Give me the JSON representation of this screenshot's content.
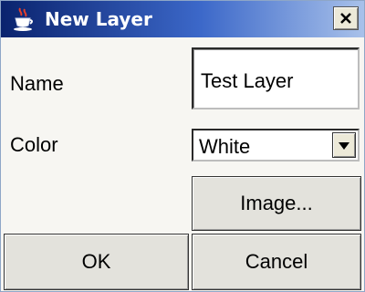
{
  "window": {
    "title": "New Layer",
    "title_icon": "java-cup-icon",
    "close_icon": "close-icon"
  },
  "form": {
    "name_label": "Name",
    "name_value": "Test Layer",
    "color_label": "Color",
    "color_value": "White",
    "dropdown_icon": "chevron-down-icon"
  },
  "buttons": {
    "image": "Image...",
    "ok": "OK",
    "cancel": "Cancel"
  },
  "colors": {
    "titlebar_start": "#0a236e",
    "titlebar_end": "#a8c1ea",
    "dialog_bg": "#f7f6f2",
    "button_bg": "#e3e2dc"
  }
}
